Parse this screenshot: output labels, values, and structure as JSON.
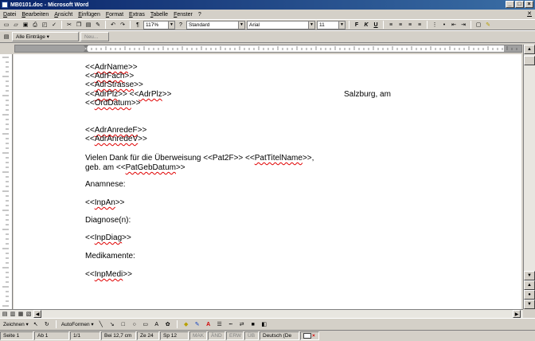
{
  "window": {
    "title": "MB0101.doc - Microsoft Word"
  },
  "menu": [
    "Datei",
    "Bearbeiten",
    "Ansicht",
    "Einfügen",
    "Format",
    "Extras",
    "Tabelle",
    "Fenster",
    "?"
  ],
  "toolbar": {
    "zoom": "117%",
    "style": "Standard",
    "font": "Arial",
    "size": "11",
    "bold": "F",
    "italic": "K",
    "underline": "U"
  },
  "toolbar2": {
    "entries_label": "Alle Einträge",
    "new_label": "Neu..."
  },
  "document": {
    "lines": [
      {
        "parts": [
          {
            "t": "<<"
          },
          {
            "t": "AdrName",
            "f": true
          },
          {
            "t": ">>"
          }
        ]
      },
      {
        "parts": [
          {
            "t": "<<"
          },
          {
            "t": "AdrFach",
            "f": true
          },
          {
            "t": ">>"
          }
        ]
      },
      {
        "parts": [
          {
            "t": "<<"
          },
          {
            "t": "AdrStrasse",
            "f": true
          },
          {
            "t": ">>"
          }
        ]
      },
      {
        "parts": [
          {
            "t": "<<"
          },
          {
            "t": "AdrPlz",
            "f": true
          },
          {
            "t": ">> <<"
          },
          {
            "t": "AdrPlz",
            "f": true
          },
          {
            "t": ">>"
          }
        ]
      },
      {
        "parts": [
          {
            "t": "<<"
          },
          {
            "t": "OrdDatum",
            "f": true
          },
          {
            "t": ">>"
          }
        ]
      },
      {
        "parts": [
          {
            "t": "<<"
          },
          {
            "t": "AdrAnredeF",
            "f": true
          },
          {
            "t": ">>"
          }
        ]
      },
      {
        "parts": [
          {
            "t": "<<"
          },
          {
            "t": "AdrAnredeV",
            "f": true
          },
          {
            "t": ">>"
          }
        ]
      },
      {
        "parts": [
          {
            "t": "Vielen Dank für die Überweisung <<Pat2F>> <<"
          },
          {
            "t": "PatTitelName",
            "f": true
          },
          {
            "t": ">>,"
          }
        ]
      },
      {
        "parts": [
          {
            "t": "geb. am <<"
          },
          {
            "t": "PatGebDatum",
            "f": true
          },
          {
            "t": ">>"
          }
        ]
      },
      {
        "parts": [
          {
            "t": "Anamnese:"
          }
        ]
      },
      {
        "parts": [
          {
            "t": "<<"
          },
          {
            "t": "InpAn",
            "f": true
          },
          {
            "t": ">>"
          }
        ]
      },
      {
        "parts": [
          {
            "t": "Diagnose(n):"
          }
        ]
      },
      {
        "parts": [
          {
            "t": "<<"
          },
          {
            "t": "InpDiag",
            "f": true
          },
          {
            "t": ">>"
          }
        ]
      },
      {
        "parts": [
          {
            "t": "Medikamente:"
          }
        ]
      },
      {
        "parts": [
          {
            "t": "<<"
          },
          {
            "t": "InpMedi",
            "f": true
          },
          {
            "t": ">>"
          }
        ]
      }
    ],
    "place_date": "Salzburg, am"
  },
  "drawbar": {
    "draw_label": "Zeichnen",
    "autoshapes_label": "AutoFormen"
  },
  "status": {
    "page": "Seite 1",
    "section": "Ab 1",
    "pages": "1/1",
    "position": "Bei 12,7 cm",
    "line": "Ze 24",
    "col": "Sp 12",
    "mak": "MAK",
    "and": "ÄND",
    "erw": "ERW",
    "ub": "ÜB",
    "language": "Deutsch (De"
  }
}
